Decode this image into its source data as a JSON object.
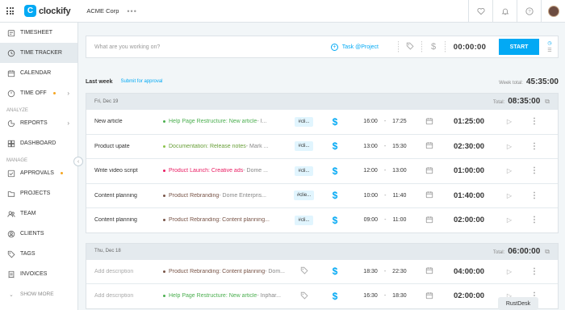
{
  "app": {
    "name": "clockify",
    "workspace": "ACME Corp",
    "workspace_menu": "•••"
  },
  "sidebar": {
    "items_top": [
      {
        "label": "TIMESHEET",
        "icon": "timesheet-icon"
      },
      {
        "label": "TIME TRACKER",
        "icon": "clock-icon",
        "active": true
      },
      {
        "label": "CALENDAR",
        "icon": "calendar-icon"
      },
      {
        "label": "TIME OFF",
        "icon": "time-off-icon",
        "dot": true,
        "arrow": true
      }
    ],
    "section_analyze": "ANALYZE",
    "items_analyze": [
      {
        "label": "REPORTS",
        "icon": "reports-icon",
        "arrow": true
      },
      {
        "label": "DASHBOARD",
        "icon": "dashboard-icon"
      }
    ],
    "section_manage": "MANAGE",
    "items_manage": [
      {
        "label": "APPROVALS",
        "icon": "approvals-icon",
        "dot": true
      },
      {
        "label": "PROJECTS",
        "icon": "projects-icon"
      },
      {
        "label": "TEAM",
        "icon": "team-icon"
      },
      {
        "label": "CLIENTS",
        "icon": "clients-icon"
      },
      {
        "label": "TAGS",
        "icon": "tags-icon"
      },
      {
        "label": "INVOICES",
        "icon": "invoices-icon"
      }
    ],
    "show_more": "SHOW MORE"
  },
  "tracker": {
    "placeholder": "What are you working on?",
    "project_label": "Task @Project",
    "timer": "00:00:00",
    "start_label": "START"
  },
  "week": {
    "label": "Last week",
    "submit_label": "Submit for approval",
    "total_label": "Week total:",
    "total": "45:35:00"
  },
  "days": [
    {
      "date": "Fri, Dec 19",
      "total_label": "Total:",
      "total": "08:35:00",
      "entries": [
        {
          "description": "New article",
          "project": "Help Page Restructure: New article",
          "task": " - I...",
          "project_color": "#4caf50",
          "project_text_color": "#4caf50",
          "tag": "#cli...",
          "start": "16:00",
          "end": "17:25",
          "duration": "01:25:00"
        },
        {
          "description": "Product upate",
          "project": "Documentation: Release notes",
          "task": " - Mark ...",
          "project_color": "#8bc34a",
          "project_text_color": "#689f38",
          "tag": "#cli...",
          "start": "13:00",
          "end": "15:30",
          "duration": "02:30:00"
        },
        {
          "description": "Write video script",
          "project": "Product Launch: Creative ads",
          "task": " - Dome ...",
          "project_color": "#e91e63",
          "project_text_color": "#e91e63",
          "tag": "#cli...",
          "start": "12:00",
          "end": "13:00",
          "duration": "01:00:00"
        },
        {
          "description": "Content planning",
          "project": "Product Rebranding",
          "task": " - Dome Enterpris...",
          "project_color": "#795548",
          "project_text_color": "#795548",
          "tag": "#clie...",
          "start": "10:00",
          "end": "11:40",
          "duration": "01:40:00"
        },
        {
          "description": "Content planning",
          "project": "Product Rebranding: Content planning...",
          "task": "",
          "project_color": "#795548",
          "project_text_color": "#795548",
          "tag": "#cli...",
          "start": "09:00",
          "end": "11:00",
          "duration": "02:00:00"
        }
      ]
    },
    {
      "date": "Thu, Dec 18",
      "total_label": "Total:",
      "total": "06:00:00",
      "entries": [
        {
          "description": "Add description",
          "placeholder": true,
          "project": "Product Rebranding: Content planning",
          "task": " - Dom...",
          "project_color": "#795548",
          "project_text_color": "#795548",
          "tag": "",
          "start": "18:30",
          "end": "22:30",
          "duration": "04:00:00"
        },
        {
          "description": "Add description",
          "placeholder": true,
          "project": "Help Page Restructure: New article",
          "task": " - Inphar...",
          "project_color": "#4caf50",
          "project_text_color": "#4caf50",
          "tag": "",
          "start": "16:30",
          "end": "18:30",
          "duration": "02:00:00"
        }
      ]
    }
  ],
  "overlay": {
    "rustdesk": "RustDesk"
  },
  "colors": {
    "accent": "#03a9f4"
  }
}
